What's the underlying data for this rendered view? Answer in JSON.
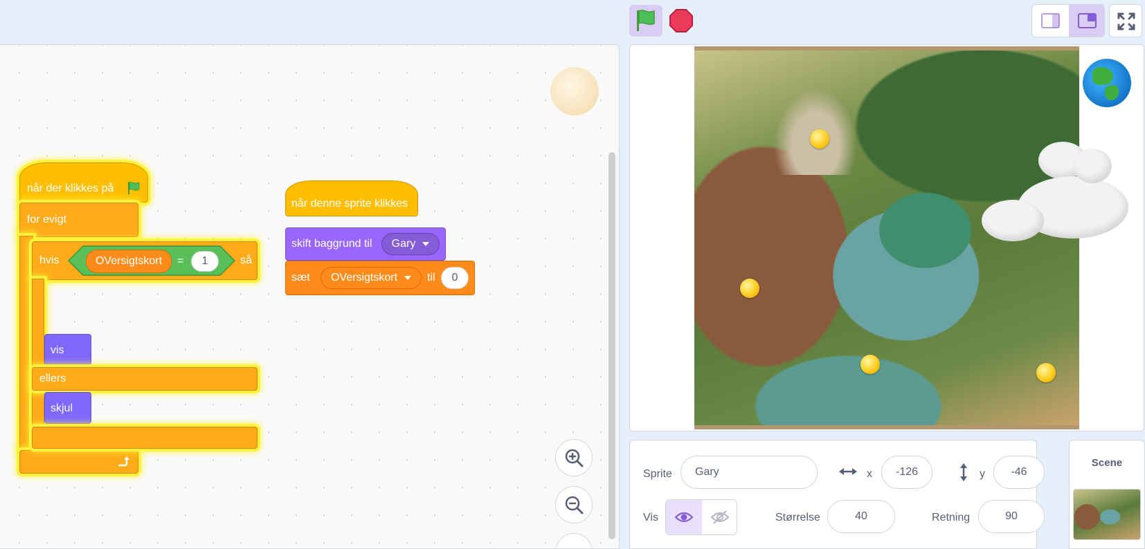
{
  "toolbar": {
    "green_flag_icon": "green-flag-icon",
    "stop_icon": "stop-sign-icon",
    "small_stage_icon": "small-stage-icon",
    "normal_stage_icon": "normal-stage-icon",
    "fullscreen_icon": "fullscreen-icon"
  },
  "scripts": {
    "script1": {
      "hat": "når der klikkes på",
      "forever": "for evigt",
      "if_label": "hvis",
      "var_name": "OVersigtskort",
      "equals": "=",
      "compare_value": "1",
      "then_label": "så",
      "show": "vis",
      "else_label": "ellers",
      "hide": "skjul"
    },
    "script2": {
      "hat": "når denne sprite klikkes",
      "switch_backdrop": "skift baggrund til",
      "backdrop_name": "Gary",
      "set_label": "sæt",
      "set_var": "OVersigtskort",
      "to_label": "til",
      "set_value": "0"
    }
  },
  "sprite_info": {
    "sprite_label": "Sprite",
    "sprite_name": "Gary",
    "x_label": "x",
    "x_value": "-126",
    "y_label": "y",
    "y_value": "-46",
    "show_label": "Vis",
    "size_label": "Størrelse",
    "size_value": "40",
    "direction_label": "Retning",
    "direction_value": "90"
  },
  "scene": {
    "title": "Scene"
  },
  "colors": {
    "control": "#ffab19",
    "events": "#ffbf00",
    "looks": "#9966ff",
    "variables": "#ff8c1a",
    "operators": "#59c059",
    "glow": "#fff23a"
  }
}
